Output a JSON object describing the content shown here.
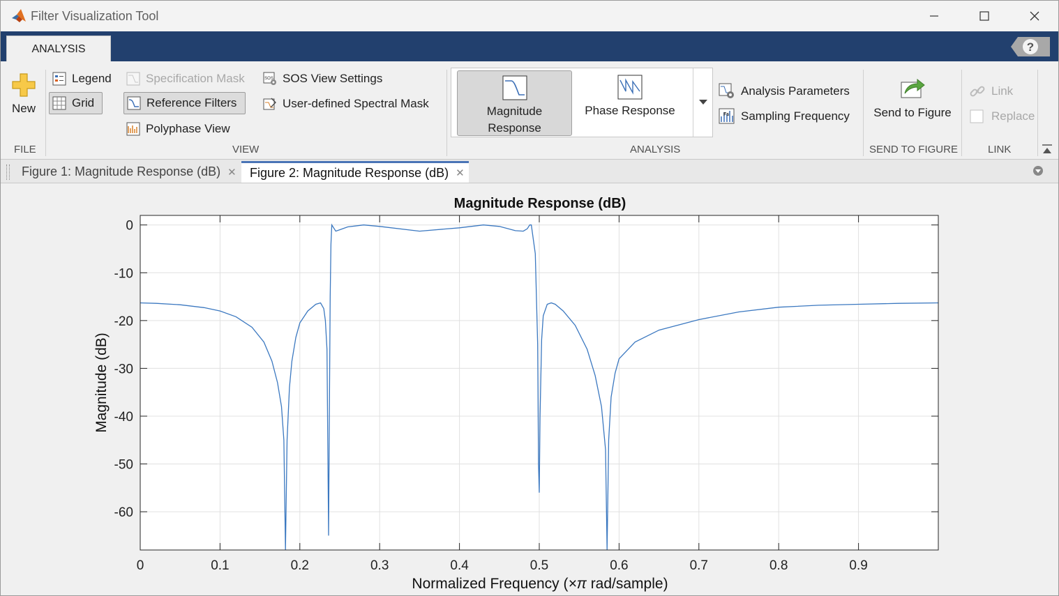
{
  "window": {
    "title": "Filter Visualization Tool"
  },
  "tabs": {
    "analysis": "ANALYSIS"
  },
  "toolstrip": {
    "file": {
      "new_label": "New",
      "group_label": "FILE"
    },
    "view": {
      "legend": "Legend",
      "grid": "Grid",
      "specification_mask": "Specification Mask",
      "reference_filters": "Reference Filters",
      "polyphase_view": "Polyphase View",
      "sos_view_settings": "SOS View Settings",
      "user_defined_spectral_mask": "User-defined Spectral Mask",
      "group_label": "VIEW"
    },
    "analysis": {
      "magnitude_line1": "Magnitude",
      "magnitude_line2": "Response",
      "phase_response": "Phase Response",
      "analysis_parameters": "Analysis Parameters",
      "sampling_frequency": "Sampling Frequency",
      "group_label": "ANALYSIS"
    },
    "send_to_figure": {
      "label": "Send to Figure",
      "group_label": "SEND TO FIGURE"
    },
    "link": {
      "link": "Link",
      "replace": "Replace",
      "group_label": "LINK"
    }
  },
  "document_tabs": [
    {
      "label": "Figure 1: Magnitude Response (dB)"
    },
    {
      "label": "Figure 2: Magnitude Response (dB)"
    }
  ],
  "chart_data": {
    "type": "line",
    "title": "Magnitude Response (dB)",
    "xlabel_pre": "Normalized  Frequency  (",
    "xlabel_sym": "×π",
    "xlabel_post": "  rad/sample)",
    "ylabel": "Magnitude (dB)",
    "xlim": [
      0,
      1
    ],
    "ylim": [
      -68,
      2
    ],
    "xticks": [
      0,
      0.1,
      0.2,
      0.3,
      0.4,
      0.5,
      0.6,
      0.7,
      0.8,
      0.9
    ],
    "xtick_labels": [
      "0",
      "0.1",
      "0.2",
      "0.3",
      "0.4",
      "0.5",
      "0.6",
      "0.7",
      "0.8",
      "0.9"
    ],
    "yticks": [
      0,
      -10,
      -20,
      -30,
      -40,
      -50,
      -60
    ],
    "ytick_labels": [
      "0",
      "-10",
      "-20",
      "-30",
      "-40",
      "-50",
      "-60"
    ],
    "grid": true,
    "series_color": "#3b78c0",
    "series": [
      {
        "x": [
          0,
          0.02,
          0.05,
          0.08,
          0.1,
          0.12,
          0.14,
          0.155,
          0.165,
          0.172,
          0.177,
          0.18,
          0.182,
          0.184,
          0.187,
          0.19,
          0.195,
          0.2,
          0.21,
          0.22,
          0.226,
          0.23,
          0.232,
          0.234,
          0.236,
          0.237,
          0.238,
          0.239,
          0.24,
          0.245,
          0.25,
          0.26,
          0.28,
          0.3,
          0.35,
          0.4,
          0.43,
          0.45,
          0.47,
          0.48,
          0.485,
          0.488,
          0.49,
          0.495,
          0.498,
          0.499,
          0.5,
          0.501,
          0.503,
          0.505,
          0.51,
          0.515,
          0.52,
          0.53,
          0.545,
          0.56,
          0.57,
          0.578,
          0.583,
          0.585,
          0.587,
          0.59,
          0.595,
          0.6,
          0.62,
          0.65,
          0.7,
          0.75,
          0.8,
          0.85,
          0.9,
          0.95,
          1.0
        ],
        "y": [
          -16.3,
          -16.4,
          -16.7,
          -17.3,
          -18.0,
          -19.2,
          -21.4,
          -24.5,
          -28.5,
          -33.0,
          -38.0,
          -45.0,
          -68.0,
          -45.0,
          -34.0,
          -28.5,
          -23.5,
          -20.5,
          -18.0,
          -16.6,
          -16.3,
          -17.5,
          -20.0,
          -26.0,
          -65.0,
          -40.0,
          -15.0,
          -4.0,
          0.0,
          -1.3,
          -1.0,
          -0.4,
          0.0,
          -0.3,
          -1.3,
          -0.6,
          0.0,
          -0.3,
          -1.2,
          -1.3,
          -0.8,
          0.0,
          0.0,
          -6.0,
          -25.0,
          -50.0,
          -56.0,
          -40.0,
          -24.0,
          -19.0,
          -16.6,
          -16.3,
          -16.6,
          -18.0,
          -21.0,
          -26.0,
          -31.5,
          -38.0,
          -47.0,
          -68.0,
          -45.0,
          -36.0,
          -31.0,
          -28.0,
          -24.5,
          -22.0,
          -19.8,
          -18.2,
          -17.2,
          -16.8,
          -16.6,
          -16.4,
          -16.3
        ]
      }
    ]
  }
}
